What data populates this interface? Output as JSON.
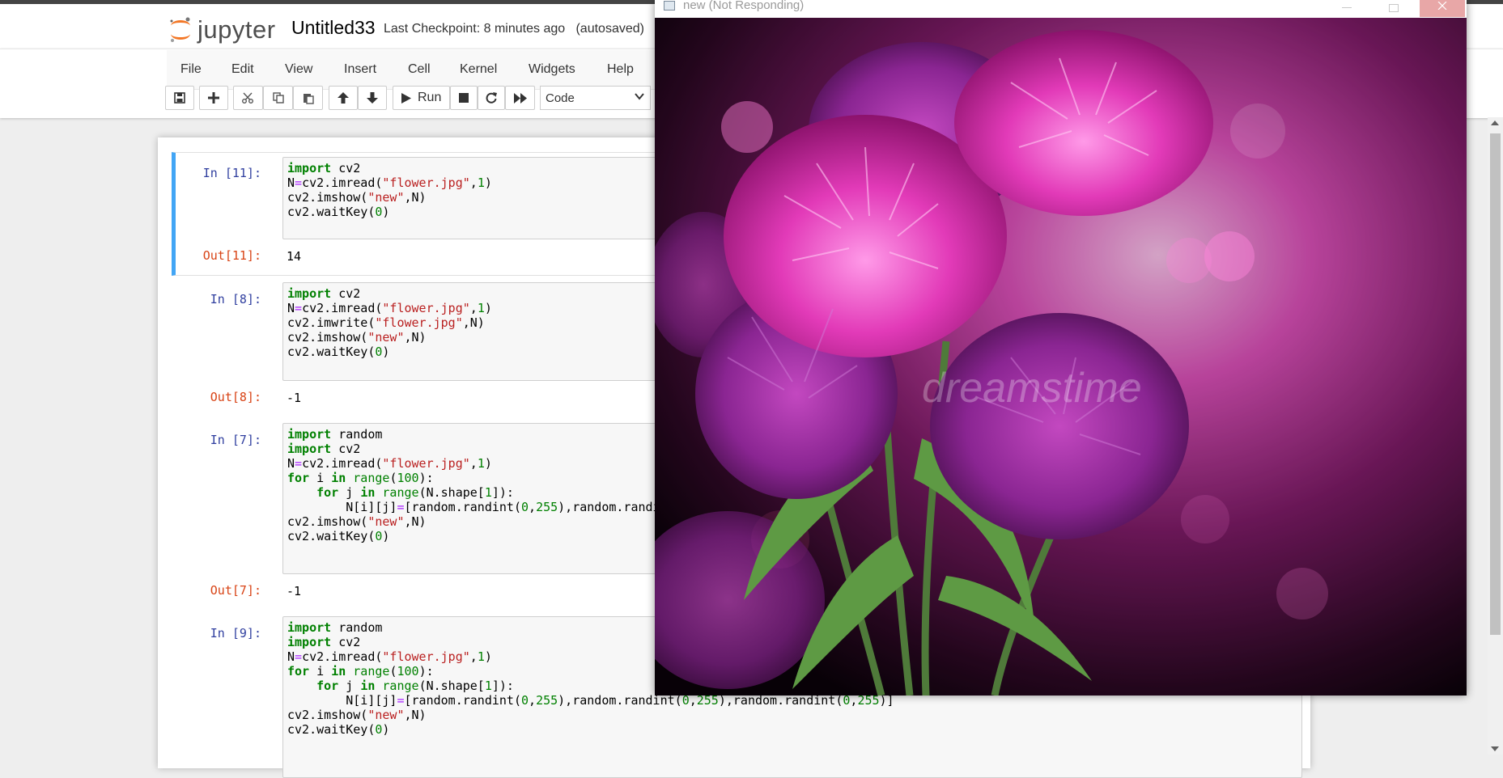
{
  "header": {
    "logo_text": "jupyter",
    "notebook_name": "Untitled33",
    "checkpoint": "Last Checkpoint: 8 minutes ago   (autosaved)"
  },
  "menu": {
    "items": [
      "File",
      "Edit",
      "View",
      "Insert",
      "Cell",
      "Kernel",
      "Widgets",
      "Help"
    ]
  },
  "toolbar": {
    "run_label": "Run",
    "cell_type": "Code"
  },
  "cells": [
    {
      "in_prompt": "In [11]:",
      "out_prompt": "Out[11]:",
      "output": "14"
    },
    {
      "in_prompt": "In [8]:",
      "out_prompt": "Out[8]:",
      "output": "-1"
    },
    {
      "in_prompt": "In [7]:",
      "out_prompt": "Out[7]:",
      "output": "-1"
    },
    {
      "in_prompt": "In [9]:"
    }
  ],
  "popup": {
    "title": "new (Not Responding)",
    "watermark": "dreamstime"
  }
}
